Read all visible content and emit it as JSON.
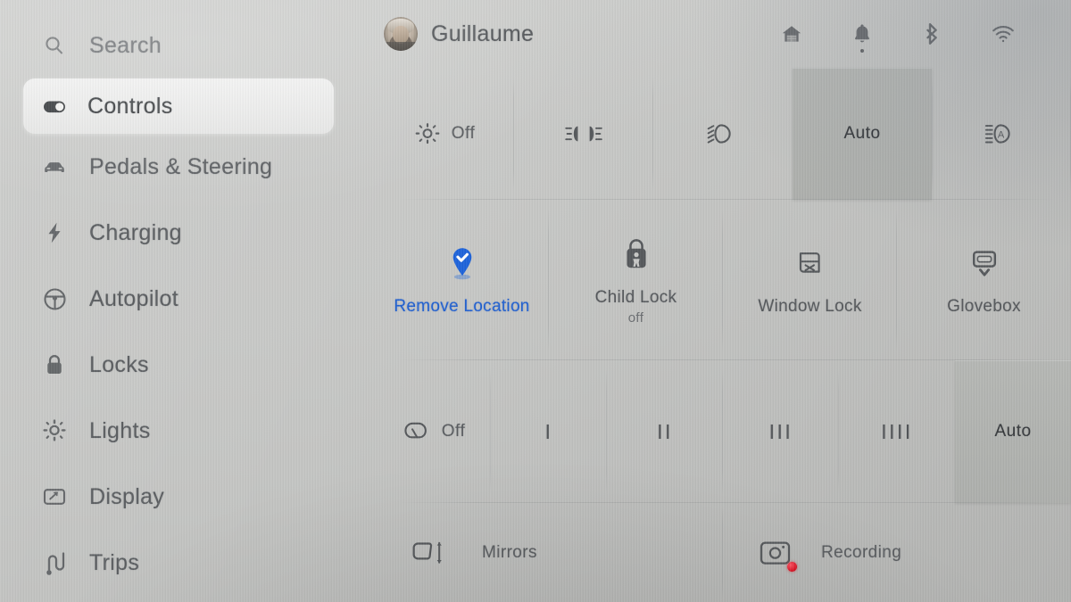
{
  "sidebar": {
    "items": [
      {
        "label": "Search",
        "icon": "search-icon",
        "active": false
      },
      {
        "label": "Controls",
        "icon": "toggle-icon",
        "active": true
      },
      {
        "label": "Pedals & Steering",
        "icon": "car-icon",
        "active": false
      },
      {
        "label": "Charging",
        "icon": "bolt-icon",
        "active": false
      },
      {
        "label": "Autopilot",
        "icon": "steering-wheel-icon",
        "active": false
      },
      {
        "label": "Locks",
        "icon": "lock-icon",
        "active": false
      },
      {
        "label": "Lights",
        "icon": "sun-icon",
        "active": false
      },
      {
        "label": "Display",
        "icon": "display-icon",
        "active": false
      },
      {
        "label": "Trips",
        "icon": "trips-icon",
        "active": false
      }
    ]
  },
  "header": {
    "profile_name": "Guillaume",
    "avatar": "user-avatar-photo",
    "status_icons": [
      {
        "name": "home-icon",
        "badge": false
      },
      {
        "name": "bell-icon",
        "badge": true
      },
      {
        "name": "bluetooth-icon",
        "badge": false
      },
      {
        "name": "wifi-icon",
        "badge": false
      }
    ]
  },
  "lights_row": {
    "segments": [
      {
        "label": "Off",
        "icon": "light-off-sun-icon",
        "selected": false
      },
      {
        "label": "",
        "icon": "parking-lights-icon",
        "selected": false
      },
      {
        "label": "",
        "icon": "low-beam-icon",
        "selected": false
      },
      {
        "label": "Auto",
        "icon": "",
        "selected": true
      },
      {
        "label": "",
        "icon": "auto-high-beam-icon",
        "selected": false
      }
    ]
  },
  "tiles_row": {
    "tiles": [
      {
        "label": "Remove Location",
        "sublabel": "",
        "icon": "map-pin-check-icon",
        "accent": true,
        "accent_color": "#1e63da"
      },
      {
        "label": "Child Lock",
        "sublabel": "off",
        "icon": "child-lock-icon",
        "accent": false
      },
      {
        "label": "Window Lock",
        "sublabel": "",
        "icon": "window-lock-icon",
        "accent": false
      },
      {
        "label": "Glovebox",
        "sublabel": "",
        "icon": "glovebox-icon",
        "accent": false
      }
    ]
  },
  "wipers_row": {
    "segments": [
      {
        "label": "Off",
        "icon": "wiper-icon",
        "selected": false
      },
      {
        "label": "I",
        "icon": "",
        "selected": false
      },
      {
        "label": "II",
        "icon": "",
        "selected": false
      },
      {
        "label": "III",
        "icon": "",
        "selected": false
      },
      {
        "label": "IIII",
        "icon": "",
        "selected": false
      },
      {
        "label": "Auto",
        "icon": "",
        "selected": true
      }
    ]
  },
  "bottom_row": {
    "items": [
      {
        "label": "Mirrors",
        "icon": "mirror-adjust-icon",
        "recording": false
      },
      {
        "label": "Recording",
        "icon": "dashcam-icon",
        "recording": true
      }
    ]
  },
  "theme": {
    "selected_fill": "#b2b4b1",
    "accent": "#1e63da",
    "record_red": "#d90f20",
    "text": "#5b5e61",
    "background": "#c7c8c6"
  }
}
